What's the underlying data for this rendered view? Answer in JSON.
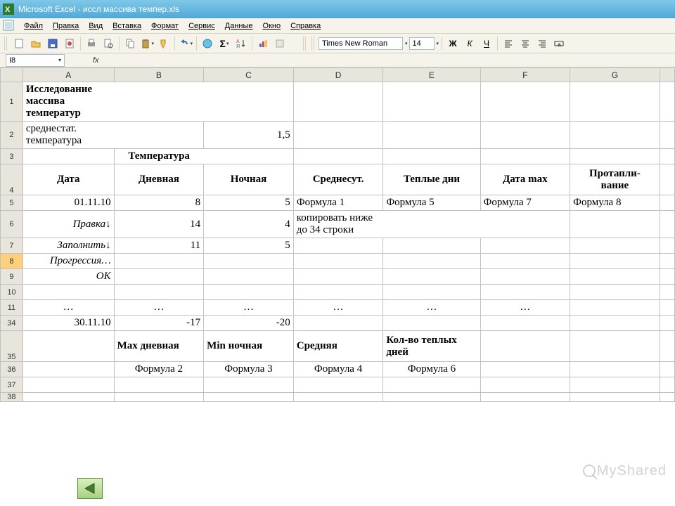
{
  "title": "Microsoft Excel - иссл массива темпер.xls",
  "menu": [
    "Файл",
    "Правка",
    "Вид",
    "Вставка",
    "Формат",
    "Сервис",
    "Данные",
    "Окно",
    "Справка"
  ],
  "toolbar": {
    "font_name": "Times New Roman",
    "font_size": "14",
    "bold": "Ж",
    "italic": "К",
    "underline": "Ч",
    "sigma": "Σ"
  },
  "namebox": "I8",
  "fx_label": "fx",
  "columns": [
    "A",
    "B",
    "C",
    "D",
    "E",
    "F",
    "G"
  ],
  "rows": {
    "r1": {
      "num": "1",
      "A": "Исследование массива температур"
    },
    "r2": {
      "num": "2",
      "A": "среднестат. температура",
      "C": "1,5"
    },
    "r3": {
      "num": "3",
      "B": "Температура"
    },
    "r4": {
      "num": "4",
      "A": "Дата",
      "B": "Дневная",
      "C": "Ночная",
      "D": "Среднесут.",
      "E": "Теплые дни",
      "F": "Дата max",
      "G": "Протапли-\nвание"
    },
    "r5": {
      "num": "5",
      "A": "01.11.10",
      "B": "8",
      "C": "5",
      "D": "Формула 1",
      "E": "Формула 5",
      "F": "Формула 7",
      "G": "Формула 8"
    },
    "r6": {
      "num": "6",
      "A": "Правка↓",
      "B": "14",
      "C": "4",
      "D": "копировать ниже до 34 строки"
    },
    "r7": {
      "num": "7",
      "A": "Заполнить↓",
      "B": "11",
      "C": "5"
    },
    "r8": {
      "num": "8",
      "A": "Прогрессия…"
    },
    "r9": {
      "num": "9",
      "A": "ОК"
    },
    "r10": {
      "num": "10"
    },
    "r11": {
      "num": "11",
      "A": "…",
      "B": "…",
      "C": "…",
      "D": "…",
      "E": "…",
      "F": "…"
    },
    "r34": {
      "num": "34",
      "A": "30.11.10",
      "B": "-17",
      "C": "-20"
    },
    "r35": {
      "num": "35",
      "B": "Max дневная",
      "C": "Min ночная",
      "D": "Средняя",
      "E": "Кол-во теплых дней"
    },
    "r36": {
      "num": "36",
      "B": "Формула 2",
      "C": "Формула 3",
      "D": "Формула 4",
      "E": "Формула 6"
    },
    "r37": {
      "num": "37"
    },
    "r38": {
      "num": "38"
    }
  },
  "watermark": "MyShared"
}
